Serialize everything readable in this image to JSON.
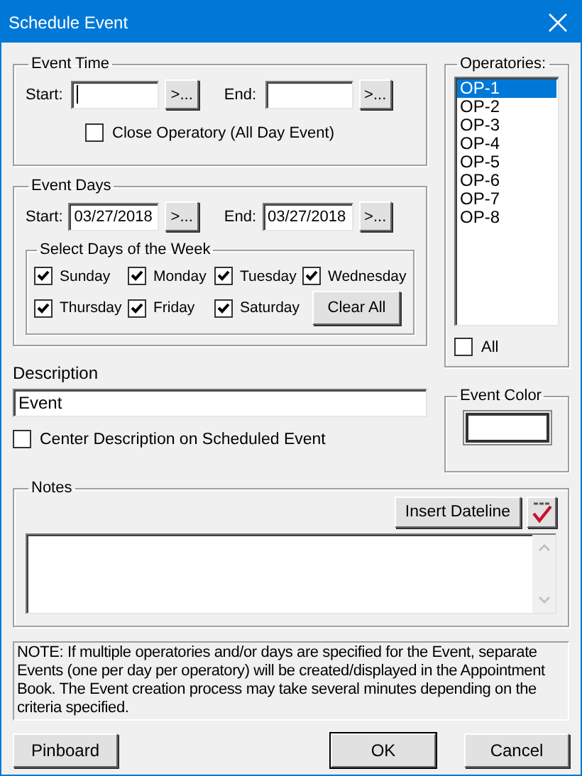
{
  "window": {
    "title": "Schedule Event"
  },
  "event_time": {
    "label": "Event Time",
    "start_label": "Start:",
    "start_button": ">...",
    "end_label": "End:",
    "end_button": ">...",
    "close_operatory": {
      "label": "Close Operatory (All Day Event)",
      "checked": false
    }
  },
  "event_days": {
    "label": "Event Days",
    "start_label": "Start:",
    "start_value": "03/27/2018",
    "start_button": ">...",
    "end_label": "End:",
    "end_value": "03/27/2018",
    "end_button": ">...",
    "week": {
      "label": "Select Days of the Week",
      "days": [
        {
          "label": "Sunday",
          "checked": true
        },
        {
          "label": "Monday",
          "checked": true
        },
        {
          "label": "Tuesday",
          "checked": true
        },
        {
          "label": "Wednesday",
          "checked": true
        },
        {
          "label": "Thursday",
          "checked": true
        },
        {
          "label": "Friday",
          "checked": true
        },
        {
          "label": "Saturday",
          "checked": true
        }
      ],
      "clear_button": "Clear All"
    }
  },
  "operatories": {
    "label": "Operatories:",
    "items": [
      {
        "label": "OP-1",
        "selected": true
      },
      {
        "label": "OP-2",
        "selected": false
      },
      {
        "label": "OP-3",
        "selected": false
      },
      {
        "label": "OP-4",
        "selected": false
      },
      {
        "label": "OP-5",
        "selected": false
      },
      {
        "label": "OP-6",
        "selected": false
      },
      {
        "label": "OP-7",
        "selected": false
      },
      {
        "label": "OP-8",
        "selected": false
      }
    ],
    "all": {
      "label": "All",
      "checked": false
    }
  },
  "description": {
    "label": "Description",
    "value": "Event",
    "center": {
      "label": "Center Description on Scheduled Event",
      "checked": false
    }
  },
  "event_color": {
    "label": "Event Color"
  },
  "notes": {
    "label": "Notes",
    "insert_button": "Insert Dateline"
  },
  "note": "NOTE: If multiple operatories and/or days are specified for the Event, separate Events (one per day per operatory) will be created/displayed in the Appointment Book.  The Event creation process may take several minutes depending on the criteria specified.",
  "buttons": {
    "pinboard": "Pinboard",
    "ok": "OK",
    "cancel": "Cancel"
  }
}
